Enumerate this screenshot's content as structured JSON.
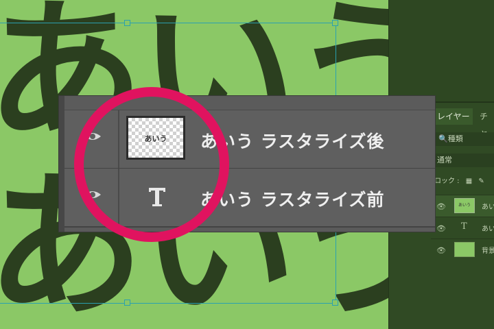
{
  "canvas": {
    "text_line1": "あいう",
    "text_line2": "あいう"
  },
  "layers_panel": {
    "tab_active": "レイヤー",
    "tab_second": "チャ",
    "search_label": "🔍種類",
    "blend_mode": "通常",
    "lock_label": "ロック :",
    "rows": [
      {
        "thumb_text": "あいう",
        "name": "あい"
      },
      {
        "name": "あい"
      },
      {
        "name": "背景"
      }
    ]
  },
  "zoom_inset": {
    "rows": [
      {
        "thumb_text": "あいう",
        "name": "あいう ラスタライズ後"
      },
      {
        "type_icon": "T",
        "name": "あいう ラスタライズ前"
      }
    ]
  },
  "colors": {
    "canvas_bg": "#8bc866",
    "text": "#2b3f1f",
    "highlight_circle": "#e0135f",
    "panel_bg": "#304a24"
  }
}
